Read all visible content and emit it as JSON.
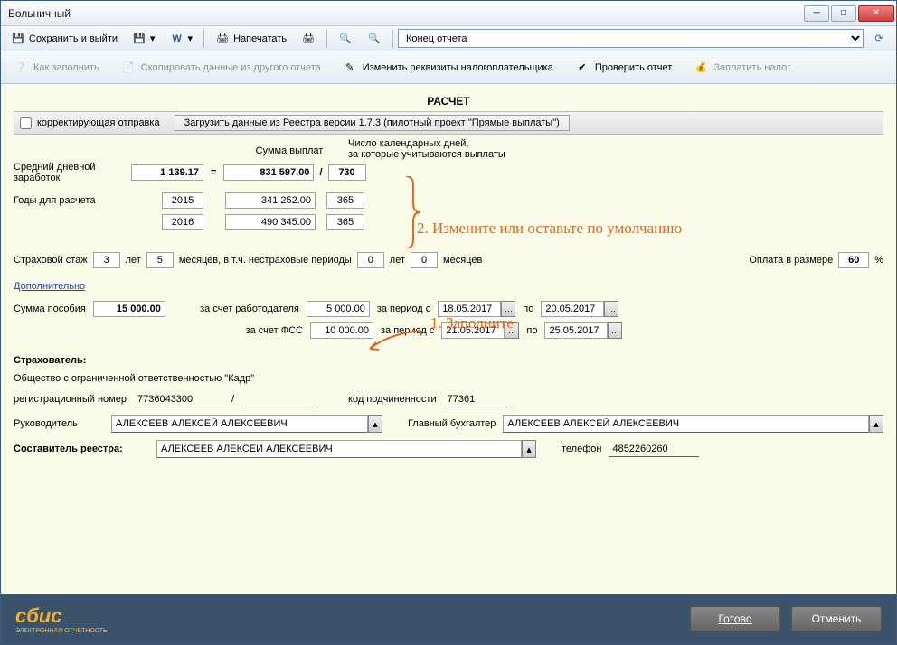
{
  "window": {
    "title": "Больничный"
  },
  "toolbar1": {
    "save_exit": "Сохранить и выйти",
    "print": "Напечатать",
    "nav_select": "Конец отчета"
  },
  "toolbar2": {
    "how_fill": "Как заполнить",
    "copy_data": "Скопировать данные из другого отчета",
    "change_req": "Изменить реквизиты налогоплательщика",
    "check_report": "Проверить отчет",
    "pay_tax": "Заплатить налог"
  },
  "section_title": "РАСЧЕТ",
  "topbar": {
    "corrective": "корректирующая отправка",
    "load_btn": "Загрузить данные из Реестра версии 1.7.3 (пилотный проект \"Прямые выплаты\")"
  },
  "headers": {
    "sum_pay": "Сумма выплат",
    "cal_days": "Число календарных дней,\nза которые учитываются выплаты"
  },
  "avg": {
    "label": "Средний дневной\nзаработок",
    "value": "1 139.17",
    "eq": "=",
    "total_sum": "831 597.00",
    "div": "/",
    "total_days": "730"
  },
  "years": {
    "label": "Годы для расчета",
    "rows": [
      {
        "year": "2015",
        "sum": "341 252.00",
        "days": "365"
      },
      {
        "year": "2016",
        "sum": "490 345.00",
        "days": "365"
      }
    ]
  },
  "annot": {
    "a1": "1. Заполните",
    "a2": "2. Измените или оставьте по умолчанию"
  },
  "staj": {
    "label": "Страховой стаж",
    "years": "3",
    "years_lbl": "лет",
    "months": "5",
    "months_lbl": "месяцев, в т.ч. нестраховые периоды",
    "ns_years": "0",
    "ns_years_lbl": "лет",
    "ns_months": "0",
    "ns_months_lbl": "месяцев",
    "pay_label": "Оплата в размере",
    "pay_pct": "60",
    "pct": "%"
  },
  "extra_link": "Дополнительно",
  "benefit": {
    "sum_label": "Сумма пособия",
    "sum": "15 000.00",
    "emp_label": "за счет работодателя",
    "emp_sum": "5 000.00",
    "fss_label": "за счет ФСС",
    "fss_sum": "10 000.00",
    "period_from": "за период с",
    "period_to": "по",
    "emp_from": "18.05.2017",
    "emp_to": "20.05.2017",
    "fss_from": "21.05.2017",
    "fss_to": "25.05.2017"
  },
  "insurer": {
    "title": "Страхователь:",
    "org": "Общество с ограниченной ответственностью \"Кадр\"",
    "reg_label": "регистрационный номер",
    "reg_no": "7736043300",
    "slash": "/",
    "sub_label": "код подчиненности",
    "sub_code": "77361",
    "head_label": "Руководитель",
    "head": "АЛЕКСЕЕВ АЛЕКСЕЙ АЛЕКСЕЕВИЧ",
    "acc_label": "Главный бухгалтер",
    "acc": "АЛЕКСЕЕВ АЛЕКСЕЙ АЛЕКСЕЕВИЧ",
    "comp_label": "Составитель реестра:",
    "comp": "АЛЕКСЕЕВ АЛЕКСЕЙ АЛЕКСЕЕВИЧ",
    "tel_label": "телефон",
    "tel": "4852260260"
  },
  "footer": {
    "logo": "сбис",
    "logo_sub": "ЭЛЕКТРОННАЯ ОТЧЕТНОСТЬ",
    "ready": "Готово",
    "cancel": "Отменить"
  }
}
